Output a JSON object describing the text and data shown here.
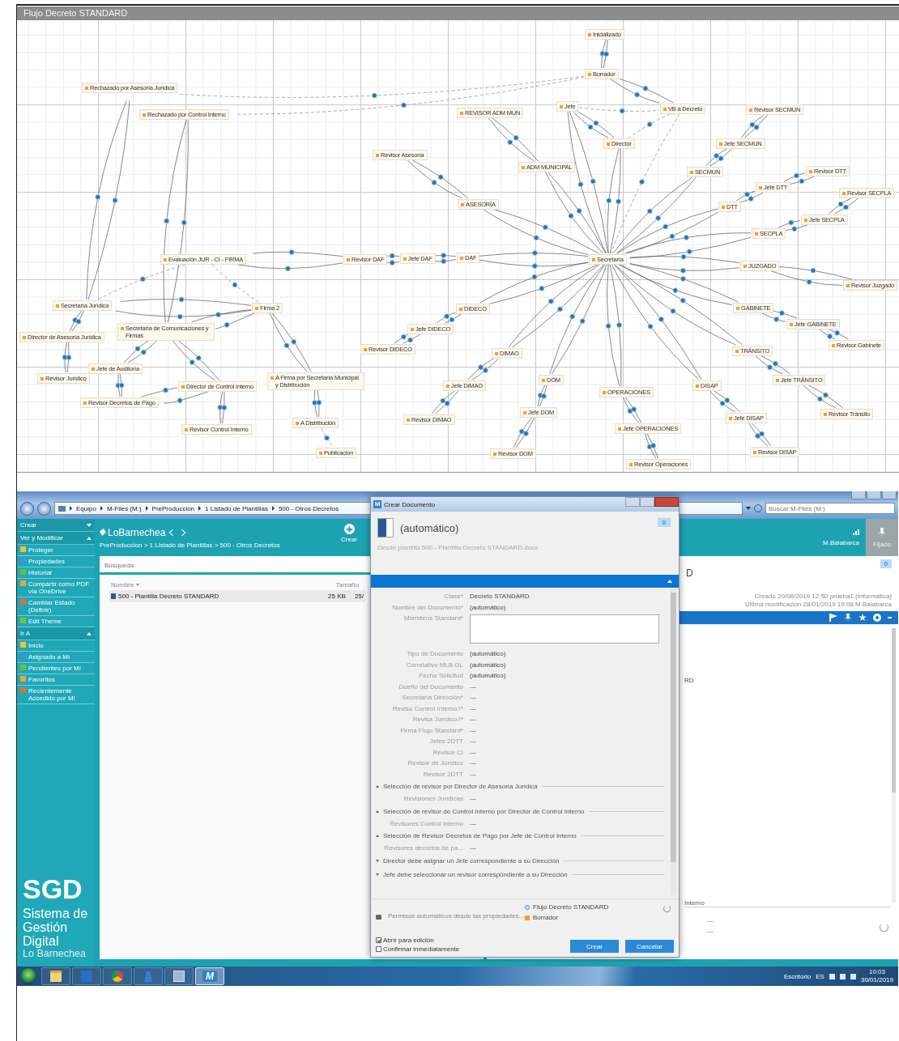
{
  "diagram": {
    "title": "Flujo Decreto STANDARD",
    "nodes": [
      {
        "label": "Inicializado"
      },
      {
        "label": "Borrador"
      },
      {
        "label": "Rechazado por Asesoría Jurídica"
      },
      {
        "label": "Rechazado por Control Interno"
      },
      {
        "label": "REVISOR ADM MUN"
      },
      {
        "label": "Jefe"
      },
      {
        "label": "VB a Decreto"
      },
      {
        "label": "Revisor SECMUN"
      },
      {
        "label": "Director"
      },
      {
        "label": "Jefe SECMUN"
      },
      {
        "label": "Revisor Asesoría"
      },
      {
        "label": "ADM MUNICIPAL"
      },
      {
        "label": "SECMUN"
      },
      {
        "label": "Revisor DTT"
      },
      {
        "label": "Jefe DTT"
      },
      {
        "label": "Revisor SECPLA"
      },
      {
        "label": "ASESORÍA"
      },
      {
        "label": "DTT"
      },
      {
        "label": "Jefe SECPLA"
      },
      {
        "label": "SECPLA"
      },
      {
        "label": "Evaluación JUR - CI - FIRMA"
      },
      {
        "label": "Revisor DAF"
      },
      {
        "label": "Jefe DAF"
      },
      {
        "label": "DAF"
      },
      {
        "label": "Secretaría"
      },
      {
        "label": "JUZGADO"
      },
      {
        "label": "Revisor Juzgado"
      },
      {
        "label": "Secretaría Jurídica"
      },
      {
        "label": "Firma 2"
      },
      {
        "label": "DIDECO"
      },
      {
        "label": "GABINETE"
      },
      {
        "label": "Director de Asesoría Jurídica"
      },
      {
        "label": "Secretaría de Comunicaciones y Firmas"
      },
      {
        "label": "Jefe DIDECO"
      },
      {
        "label": "Jefe GABINETE"
      },
      {
        "label": "Revisor DIDECO"
      },
      {
        "label": "DIMAO"
      },
      {
        "label": "TRÁNSITO"
      },
      {
        "label": "Revisor Gabinete"
      },
      {
        "label": "Revisor Jurídico"
      },
      {
        "label": "Jefe de Auditoría"
      },
      {
        "label": "Director de Control Interno"
      },
      {
        "label": "A Firma por Secretaría Municipal y Distribución"
      },
      {
        "label": "Jefe DIMAO"
      },
      {
        "label": "DOM"
      },
      {
        "label": "OPERACIONES"
      },
      {
        "label": "DISAP"
      },
      {
        "label": "Jefe TRÁNSITO"
      },
      {
        "label": "Revisor Decretos de Pago"
      },
      {
        "label": "Revisor Control Interno"
      },
      {
        "label": "A Distribución"
      },
      {
        "label": "Revisor DIMAO"
      },
      {
        "label": "Jefe DOM"
      },
      {
        "label": "Jefe OPERACIONES"
      },
      {
        "label": "Jefe DISAP"
      },
      {
        "label": "Revisor Tránsito"
      },
      {
        "label": "Publicación"
      },
      {
        "label": "Revisor DOM"
      },
      {
        "label": "Revisor Operaciones"
      },
      {
        "label": "Revisor DISAP"
      }
    ]
  },
  "address_bar": {
    "path": [
      "Equipo",
      "M-Files (M:)",
      "PreProduccion",
      "1 Listado de Plantillas",
      "500 - Otros Decretos"
    ],
    "search_placeholder": "Buscar M-Files (M:)"
  },
  "sidebar": {
    "sections": [
      {
        "title": "Crear",
        "expanded": false
      },
      {
        "title": "Ver y Modificar",
        "expanded": true,
        "items": [
          "Proteger",
          "Propiedades",
          "Historial",
          "Compartir como PDF vía OneDrive",
          "Cambiar Estado (Definir)",
          "Edit Theme"
        ]
      },
      {
        "title": "Ir A",
        "expanded": true,
        "items": [
          "Inicio",
          "Asignado a Mí",
          "Pendientes por Mí",
          "Favoritos",
          "Recientemente Accedido por Mí"
        ]
      }
    ],
    "logo": {
      "title": "SGD",
      "subtitle": "Sistema de Gestión Digital",
      "org": "Lo Barnechea"
    }
  },
  "header": {
    "brand": "LoBarnechea",
    "path": "PreProduccion > 1 Listado de Plantillas > 500 - Otros Decretos",
    "create_button": "Crear",
    "user": "M.Balabarca",
    "pin_label": "Fijado"
  },
  "list": {
    "search_placeholder": "Búsqueda",
    "columns": [
      "Nombre",
      "Tamaño"
    ],
    "rows": [
      {
        "name": "500 - Plantilla Decreto STANDARD",
        "size": "25 KB",
        "date": "25/"
      }
    ]
  },
  "details": {
    "count": "0",
    "partial_title": "D",
    "meta": [
      "Creado 20/08/2019 12:50 prueba1 (Informática)",
      "Última modificación 28/01/2019 19:08 M.Balabarca"
    ],
    "partial_value": "RD",
    "partial_section": "Interno",
    "values": [
      "---",
      "---"
    ]
  },
  "dialog": {
    "icon_label": "M",
    "title": "Crear Documento",
    "name": "(automático)",
    "template": "Desde plantilla 500 - Plantilla Decreto STANDARD.docx",
    "badge": "0",
    "form": [
      {
        "kind": "field",
        "label": "Clase*",
        "value": "Decreto STANDARD"
      },
      {
        "kind": "field",
        "label": "Nombre del Documento*",
        "value": "(automático)"
      },
      {
        "kind": "textarea",
        "label": "Miembros Standard*"
      },
      {
        "kind": "field",
        "label": "Tipo de Documento",
        "value": "(automático)"
      },
      {
        "kind": "field",
        "label": "Correlativo MLB GL",
        "value": "(automático)"
      },
      {
        "kind": "field",
        "label": "Fecha Solicitud",
        "value": "(automático)"
      },
      {
        "kind": "field",
        "label": "Dueño del Documento",
        "value": "---"
      },
      {
        "kind": "field",
        "label": "Secretaría Dirección*",
        "value": "---"
      },
      {
        "kind": "field",
        "label": "Revisa Control Interno?*",
        "value": "---"
      },
      {
        "kind": "field",
        "label": "Revisa Jurídico?*",
        "value": "---"
      },
      {
        "kind": "field",
        "label": "Firma Flujo Standard*",
        "value": "---"
      },
      {
        "kind": "field",
        "label": "Jefes 2DTT",
        "value": "---"
      },
      {
        "kind": "field",
        "label": "Revisor CI",
        "value": "---"
      },
      {
        "kind": "field",
        "label": "Revisor de Jurídico",
        "value": "---"
      },
      {
        "kind": "field",
        "label": "Revisor 2DTT",
        "value": "---"
      },
      {
        "kind": "section",
        "title": "Selección de revisor por Director de Asesoría Jurídica",
        "expanded": true
      },
      {
        "kind": "field",
        "label": "Revisiones Jurídicas",
        "value": "---"
      },
      {
        "kind": "section",
        "title": "Selección de revisor de Control Interno por Director de Control Interno",
        "expanded": true
      },
      {
        "kind": "field",
        "label": "Revisores Control Interno",
        "value": "---"
      },
      {
        "kind": "section",
        "title": "Selección de Revisor Decretos de Pago por Jefe de Control Interno",
        "expanded": true
      },
      {
        "kind": "field",
        "label": "Revisores decretos de pa...",
        "value": "---"
      },
      {
        "kind": "section",
        "title": "Director debe asignar un Jefe correspondiente a su Dirección",
        "expanded": false
      },
      {
        "kind": "section",
        "title": "Jefe debe seleccionar un revisor correspondiente a su Dirección",
        "expanded": false
      }
    ],
    "permissions": "Permisos automáticos desde las propiedades...",
    "workflow": "Flujo Decreto STANDARD",
    "state": "Borrador",
    "options": [
      {
        "label": "Abrir para edición",
        "checked": true
      },
      {
        "label": "Confirmar inmediatamente",
        "checked": false
      }
    ],
    "buttons": [
      "Crear",
      "Cancelar"
    ]
  },
  "taskbar": {
    "apps": [
      {
        "kind": "folder",
        "selected": false
      },
      {
        "kind": "outlook",
        "selected": false
      },
      {
        "kind": "chrome",
        "selected": false
      },
      {
        "kind": "users",
        "selected": false
      },
      {
        "kind": "window",
        "selected": false
      },
      {
        "kind": "mfiles",
        "label": "M",
        "selected": true
      }
    ],
    "desktop": "Escritorio",
    "language": "ES",
    "time": "10:03",
    "date": "30/01/2019"
  }
}
